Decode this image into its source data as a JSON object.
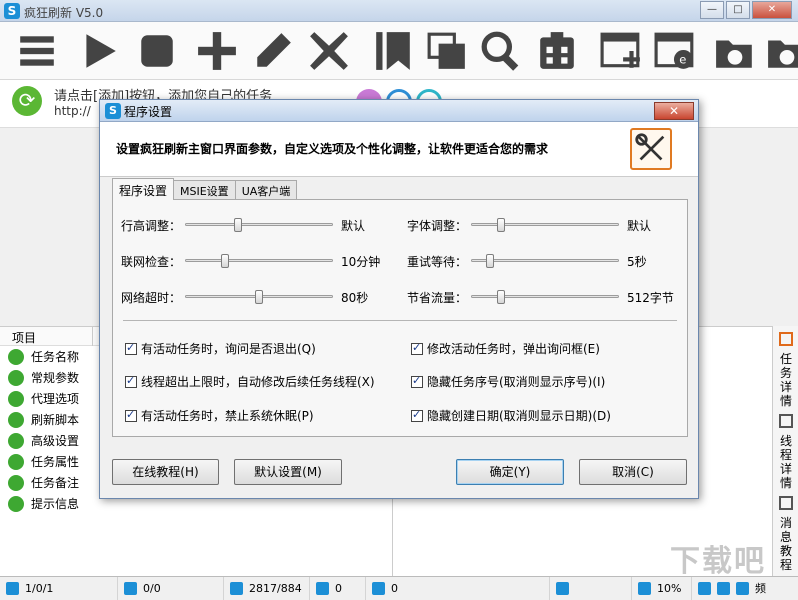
{
  "window": {
    "title": "疯狂刷新 V5.0",
    "controls": [
      "—",
      "□",
      "✕"
    ]
  },
  "toolbar": [
    "menu-icon",
    "play-icon",
    "stop-icon",
    "add-icon",
    "edit-icon",
    "delete-icon",
    "bookmark-icon",
    "copy-icon",
    "search-icon",
    "clipboard-icon",
    "new-window-icon",
    "ie-window-icon",
    "folder-export-icon",
    "folder-import-icon"
  ],
  "notice": {
    "text": "请点击[添加]按钮，添加您自己的任务",
    "url": "http://"
  },
  "left_panel": {
    "header": "项目",
    "items": [
      "任务名称",
      "常规参数",
      "代理选项",
      "刷新脚本",
      "高级设置",
      "任务属性",
      "任务备注",
      "提示信息"
    ]
  },
  "side_tabs": [
    "任务详情",
    "线程详情",
    "消息教程"
  ],
  "watermark": "下载吧",
  "status": {
    "tasks": "1/0/1",
    "refresh": "0/0",
    "counts": "2817/884",
    "down": "0",
    "ie": "0",
    "percent": "10%",
    "last": "频"
  },
  "dialog": {
    "title": "程序设置",
    "close": "✕",
    "description": "设置疯狂刷新主窗口界面参数，自定义选项及个性化调整，让软件更适合您的需求",
    "tabs": [
      "程序设置",
      "MSIE设置",
      "UA客户端"
    ],
    "sliders": [
      {
        "label": "行高调整：",
        "value": "默认",
        "level": 0.35
      },
      {
        "label": "字体调整：",
        "value": "默认",
        "level": 0.18
      },
      {
        "label": "联网检查：",
        "value": "10分钟",
        "level": 0.25
      },
      {
        "label": "重试等待：",
        "value": "5秒",
        "level": 0.1
      },
      {
        "label": "网络超时：",
        "value": "80秒",
        "level": 0.5
      },
      {
        "label": "节省流量：",
        "value": "512字节",
        "level": 0.18
      }
    ],
    "checkboxes": [
      {
        "label": "有活动任务时，询问是否退出(Q)",
        "checked": true
      },
      {
        "label": "修改活动任务时，弹出询问框(E)",
        "checked": true
      },
      {
        "label": "线程超出上限时，自动修改后续任务线程(X)",
        "checked": true
      },
      {
        "label": "隐藏任务序号(取消则显示序号)(I)",
        "checked": true
      },
      {
        "label": "有活动任务时，禁止系统休眠(P)",
        "checked": true
      },
      {
        "label": "隐藏创建日期(取消则显示日期)(D)",
        "checked": true
      }
    ],
    "buttons": {
      "online": "在线教程(H)",
      "defaults": "默认设置(M)",
      "ok": "确定(Y)",
      "cancel": "取消(C)"
    }
  }
}
